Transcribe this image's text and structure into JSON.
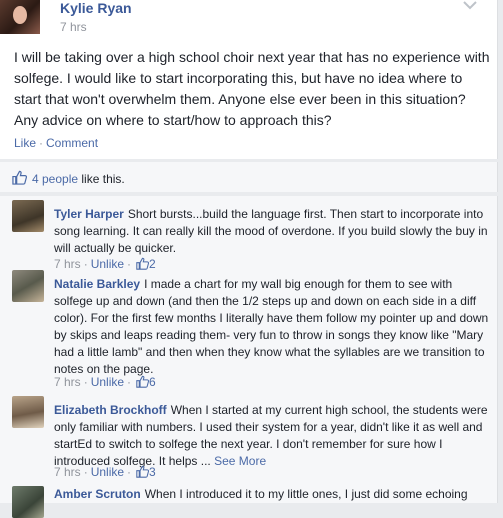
{
  "post": {
    "author": "Kylie Ryan",
    "time": "7 hrs",
    "body": "I will be taking over a high school choir next year that has no experience with solfege. I would like to start incorporating this, but have no idea where to start that won't overwhelm them. Anyone else ever been in this situation? Any advice on where to start/how to approach this?",
    "like_label": "Like",
    "comment_label": "Comment"
  },
  "likes": {
    "count_text": "4 people",
    "suffix": "like this."
  },
  "comments": [
    {
      "name": "Tyler Harper",
      "text": "Short bursts...build the language first. Then start to incorporate into song learning. It can really kill the mood of overdone. If you build slowly the buy in will actually be quicker.",
      "time": "7 hrs",
      "unlike": "Unlike",
      "likes": "2"
    },
    {
      "name": "Natalie Barkley",
      "text": "I made a chart for my wall big enough for them to see with solfege up and down (and then the 1/2 steps up and down on each side in a diff color). For the first few months I literally have them follow my pointer up and down by skips and leaps reading them- very fun to throw in songs they know like \"Mary had a little lamb\" and then when they know what the syllables are we transition to notes on the page.",
      "time": "7 hrs",
      "unlike": "Unlike",
      "likes": "6"
    },
    {
      "name": "Elizabeth Brockhoff",
      "text": "When I started at my current high school, the students were only familiar with numbers. I used their system for a year, didn't like it as well and startEd to switch to solfege the next year. I don't remember for sure how I introduced solfege. It helps ...",
      "see_more": "See More",
      "time": "7 hrs",
      "unlike": "Unlike",
      "likes": "3"
    },
    {
      "name": "Amber Scruton",
      "text": "When I introduced it to my little ones, I just did some echoing"
    }
  ],
  "colors": {
    "link": "#3b5998",
    "muted": "#90949c",
    "background": "#e9ebee"
  },
  "icons": {
    "post_menu": "chevron-down-icon",
    "like": "thumbs-up-icon"
  }
}
